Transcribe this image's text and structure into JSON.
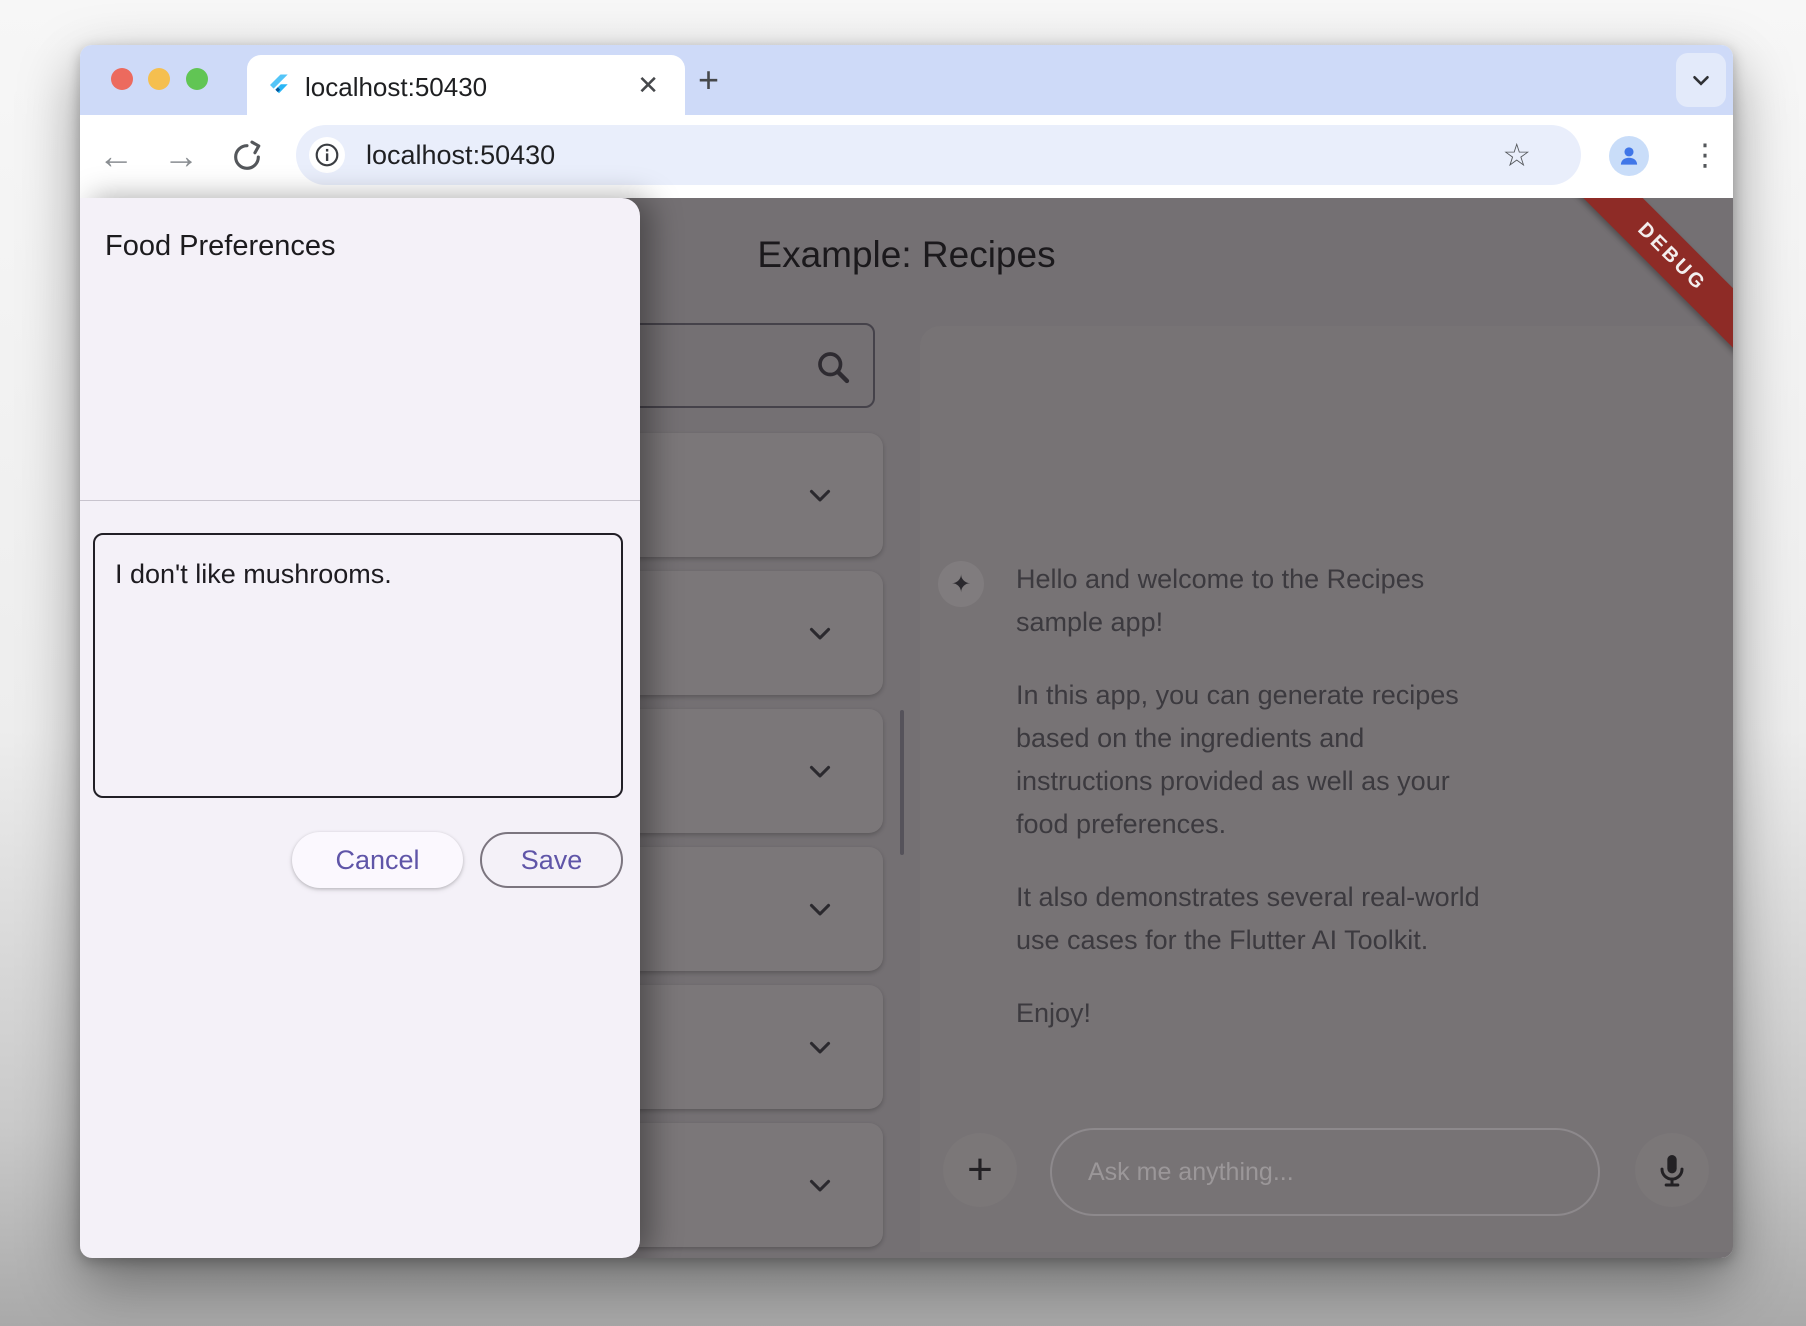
{
  "browser": {
    "traffic_lights": [
      "close",
      "minimize",
      "zoom"
    ],
    "tab": {
      "title": "localhost:50430",
      "close_glyph": "✕"
    },
    "new_tab_glyph": "+",
    "toolbar": {
      "back_glyph": "←",
      "forward_glyph": "→",
      "url": "localhost:50430",
      "bookmark_glyph": "☆",
      "menu_glyph": "⋮"
    }
  },
  "drawer": {
    "title": "Food Preferences",
    "preferences_input": {
      "value": "I don't like mushrooms."
    },
    "cancel_label": "Cancel",
    "save_label": "Save"
  },
  "main": {
    "app_bar": {
      "title": "Example: Recipes"
    },
    "debug_banner": "DEBUG",
    "recipe_list": {
      "visible_collapsed_rows": 6
    },
    "chat": {
      "llm_icon_glyph": "✦",
      "messages": [
        {
          "role": "llm",
          "paragraphs": [
            "Hello and welcome to the Recipes sample app!",
            "In this app, you can generate recipes based on the ingredients and instructions provided as well as your food preferences.",
            "It also demonstrates several real-world use cases for the Flutter AI Toolkit.",
            "Enjoy!"
          ]
        }
      ],
      "input": {
        "placeholder": "Ask me anything...",
        "attach_glyph": "+"
      }
    }
  },
  "icons": {
    "search-icon": "magnifier shape",
    "chevron-down-icon": "v shape",
    "mic-icon": "microphone shape",
    "flutter-logo": "blue double chevron",
    "info-icon": "circled i",
    "profile-icon": "person silhouette"
  },
  "colors": {
    "accent_purple": "#5f55a8",
    "debug_red": "#8e2b26",
    "tabstrip_blue": "#cedaf8",
    "omnibox_blue": "#e9eefb",
    "drawer_bg": "#f4f1f8",
    "dimmed_backdrop": "#747073",
    "dimmed_card": "#7b7779"
  }
}
